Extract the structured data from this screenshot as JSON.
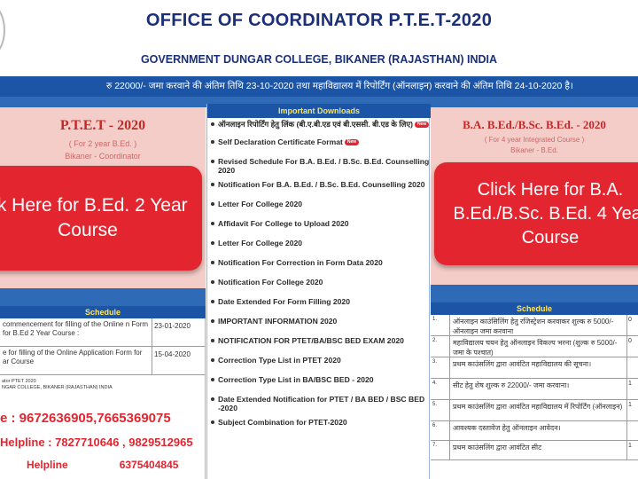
{
  "header": {
    "title": "OFFICE OF COORDINATOR P.T.E.T-2020",
    "subtitle": "GOVERNMENT DUNGAR COLLEGE, BIKANER (RAJASTHAN) INDIA"
  },
  "marquee": {
    "text": "रु 22000/- जमा करवाने की अंतिम तिथि 23-10-2020 तथा महाविद्यालय में रिपोर्टिंग (ऑनलाइन) करवाने की अंतिम तिथि 24-10-2020 है।"
  },
  "left": {
    "heading": "P.T.E.T - 2020",
    "sub1": "( For 2 year B.Ed. )",
    "sub2": "Bikaner - Coordinator",
    "cta_line1": "ck Here for B.Ed. 2 Year",
    "cta_line2": "Course",
    "schedule_title": "Schedule",
    "schedule": [
      {
        "desc": "commencement for filling of the Online n Form for B.Ed 2 Year Course :",
        "date": "23-01-2020"
      },
      {
        "desc": "e for filling of the Online Application Form for ar Course",
        "date": "15-04-2020"
      }
    ],
    "contact_small1": "ator PTET 2020",
    "contact_small2": "NGAR COLLEGE, BIKANER (RAJASTHAN) INDIA",
    "phone_main": "e : 9672636905,7665369075",
    "helpline1": "Helpline : 7827710646 , 9829512965",
    "helpline2_label": "Helpline",
    "helpline2_number": "6375404845"
  },
  "center": {
    "heading": "Important Downloads",
    "downloads": [
      {
        "label": "ऑनलाइन रिपोर्टिंग हेतु लिंक (बी.ए.बी.एड एवं बी.एससी. बी.एड के लिए)",
        "new": true,
        "new_label": "New"
      },
      {
        "label": "Self Declaration Certificate Format",
        "new": true,
        "new_label": "New"
      },
      {
        "label": "Revised Schedule For B.A. B.Ed. / B.Sc. B.Ed. Counselling 2020",
        "new": false
      },
      {
        "label": "Notification For B.A. B.Ed. / B.Sc. B.Ed. Counselling 2020",
        "new": false
      },
      {
        "label": "Letter For College 2020",
        "new": false
      },
      {
        "label": "Affidavit For College to Upload 2020",
        "new": false
      },
      {
        "label": "Letter For College 2020",
        "new": false
      },
      {
        "label": "Notification For Correction in Form Data 2020",
        "new": false
      },
      {
        "label": "Notification For College 2020",
        "new": false
      },
      {
        "label": "Date Extended For Form Filling 2020",
        "new": false
      },
      {
        "label": "IMPORTANT INFORMATION 2020",
        "new": false
      },
      {
        "label": "NOTIFICATION FOR PTET/BA/BSC BED EXAM 2020",
        "new": false
      },
      {
        "label": "Correction Type List in PTET 2020",
        "new": false
      },
      {
        "label": "Correction Type List in BA/BSC BED - 2020",
        "new": false
      },
      {
        "label": "Date Extended Notification for PTET / BA BED / BSC BED -2020",
        "new": false
      },
      {
        "label": "Subject Combination for PTET-2020",
        "new": false
      }
    ]
  },
  "right": {
    "heading": "B.A. B.Ed./B.Sc. B.Ed. - 2020",
    "sub1": "( For 4 year Integrated Course )",
    "sub2": "Bikaner - B.Ed.",
    "cta_line1": "Click Here for B.A.",
    "cta_line2": "B.Ed./B.Sc. B.Ed. 4 Year",
    "cta_line3": "Course",
    "schedule_title": "Schedule",
    "schedule": [
      {
        "num": "1.",
        "desc": "ऑनलाइन काउंसिलिंग हेतु रजिस्ट्रेशन करवाकर शुल्क रु 5000/- ऑनलाइन जमा करवाना",
        "val": "0"
      },
      {
        "num": "2.",
        "desc": "महाविद्यालय चयन हेतु ऑनलाइन विकल्प भरना (शुल्क रु 5000/- जमा के पश्चात)",
        "val": "0"
      },
      {
        "num": "3.",
        "desc": "प्रथम काउंसलिंग द्वारा आवंटित महाविद्यालय की सूचना।",
        "val": ""
      },
      {
        "num": "4.",
        "desc": "सीट हेतु शेष शुल्क रु 22000/- जमा करवाना।",
        "val": "1"
      },
      {
        "num": "5.",
        "desc": "प्रथम काउंसलिंग द्वारा आवंटित महाविद्यालय में रिपोर्टिंग (ऑनलाइन)",
        "val": "1"
      },
      {
        "num": "6.",
        "desc": "आवश्यक दस्तावेज हेतु ऑनलाइन आवेदन।",
        "val": ""
      },
      {
        "num": "7.",
        "desc": "प्रथम काउंसलिंग द्वारा आवंटित सीट",
        "val": "1"
      }
    ]
  }
}
